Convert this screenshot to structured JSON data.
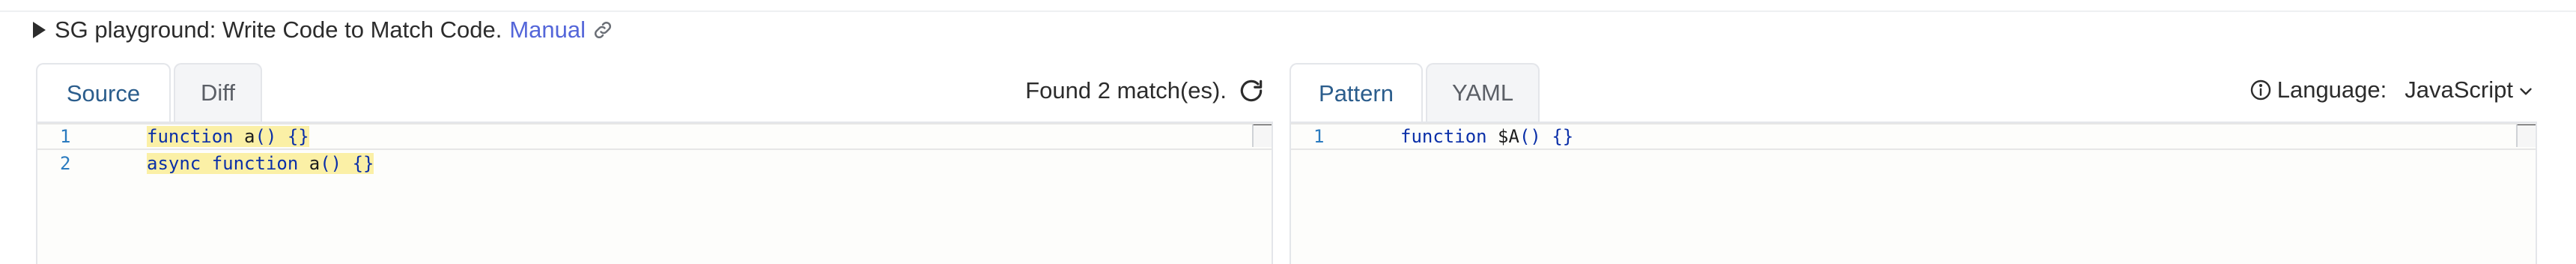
{
  "summary": {
    "text": "SG playground: Write Code to Match Code.",
    "link_label": "Manual",
    "link_icon": "link-icon"
  },
  "source_panel": {
    "tabs": [
      {
        "label": "Source",
        "active": true
      },
      {
        "label": "Diff",
        "active": false
      }
    ],
    "match_status": "Found 2 match(es).",
    "refresh_icon": "refresh-icon",
    "lines": [
      {
        "number": "1",
        "tokens": [
          "function",
          " ",
          "a",
          "()",
          " ",
          "{}"
        ]
      },
      {
        "number": "2",
        "tokens": [
          "async",
          " ",
          "function",
          " ",
          "a",
          "()",
          " ",
          "{}"
        ]
      }
    ]
  },
  "pattern_panel": {
    "tabs": [
      {
        "label": "Pattern",
        "active": true
      },
      {
        "label": "YAML",
        "active": false
      }
    ],
    "info_icon": "info-icon",
    "language_label": "Language:",
    "language_value": "JavaScript",
    "dropdown_icon": "chevron-down-icon",
    "lines": [
      {
        "number": "1",
        "tokens": [
          "function",
          " ",
          "$A",
          "()",
          " ",
          "{}"
        ]
      }
    ]
  },
  "colors": {
    "accent_tab": "#2b5d8c",
    "link": "#5466d9",
    "match_highlight": "#fbf0a6",
    "keyword": "#0a2fa8",
    "line_number": "#2b7bbf"
  }
}
